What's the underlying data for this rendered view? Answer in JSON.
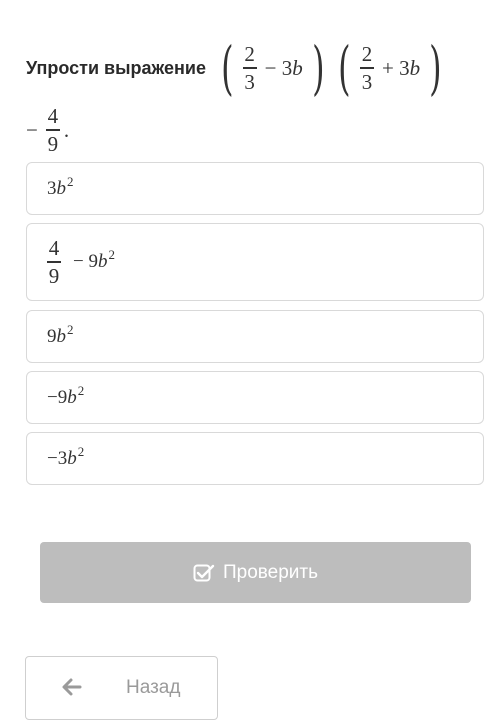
{
  "question": {
    "prompt": "Упрости выражение",
    "expr": {
      "frac1_num": "2",
      "frac1_den": "3",
      "op1": "− 3",
      "var1": "b",
      "frac2_num": "2",
      "frac2_den": "3",
      "op2": "+ 3",
      "var2": "b",
      "minus": "−",
      "frac3_num": "4",
      "frac3_den": "9",
      "period": "."
    }
  },
  "options": [
    {
      "coef": "3",
      "var": "b",
      "exp": "2"
    },
    {
      "frac_num": "4",
      "frac_den": "9",
      "rest_coef": "− 9",
      "var": "b",
      "exp": "2"
    },
    {
      "coef": "9",
      "var": "b",
      "exp": "2"
    },
    {
      "coef": "−9",
      "var": "b",
      "exp": "2"
    },
    {
      "coef": "−3",
      "var": "b",
      "exp": "2"
    }
  ],
  "buttons": {
    "check_label": "Проверить",
    "back_label": "Назад"
  },
  "colors": {
    "check_bg": "#bdbdbd",
    "border": "#d9d9d9",
    "muted_text": "#9a9a9a"
  },
  "icons": {
    "check": "checkbox-checked-icon",
    "back": "arrow-left-icon"
  }
}
